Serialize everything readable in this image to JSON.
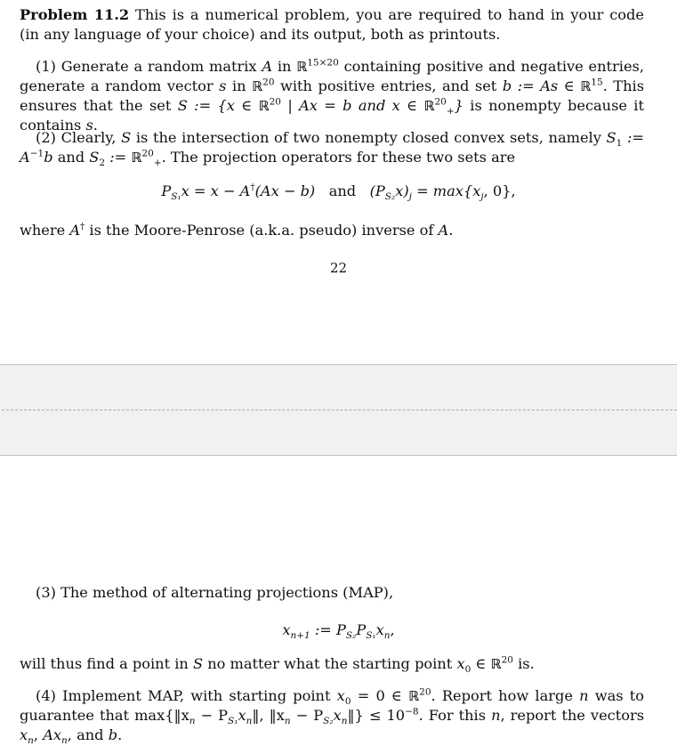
{
  "page1": {
    "problem_label": "Problem 11.2",
    "intro": " This is a numerical problem, you are required to hand in your code (in any language of your choice) and its output, both as printouts.",
    "part1": {
      "t1": "(1) Generate a random matrix ",
      "A": "A",
      "t2": " in ",
      "R": "ℝ",
      "dims": "15×20",
      "t3": " containing positive and negative entries, generate a random vector ",
      "s": "s",
      "t4": " in ",
      "dim20": "20",
      "t5": " with positive entries, and set ",
      "b_eq": "b := As ∈ ",
      "dim15": "15",
      "t6": ". This ensures that the set ",
      "set_def": "S := {x ∈ ",
      "set_mid": " | Ax = b and x ∈ ",
      "plus": "+",
      "set_end": "}",
      "t7": " is nonempty because it contains ",
      "t8": "."
    },
    "part2": {
      "t1": "(2) Clearly, ",
      "S": "S",
      "t2": " is the intersection of two nonempty closed convex sets, namely ",
      "S1def": "S",
      "S1sub": "1",
      "S1rest": " := A",
      "inv": "−1",
      "S1b": "b",
      "t3": " and ",
      "S2def": "S",
      "S2sub": "2",
      "S2rest": " := ",
      "t4": ". The projection operators for these two sets are"
    },
    "equation1": {
      "lhs": "P",
      "lhs_sub": "S₁",
      "lhs_rest": "x = x − A",
      "dagger": "†",
      "lhs_tail": "(Ax − b)",
      "and": "and",
      "rhs": "(P",
      "rhs_sub": "S₂",
      "rhs_mid": "x)",
      "rhs_j": "j",
      "rhs_tail": " = max{x",
      "rhs_tail2": ", 0},"
    },
    "where": {
      "t1": "where ",
      "A": "A",
      "dagger": "†",
      "t2": " is the Moore-Penrose (a.k.a. pseudo) inverse of ",
      "t3": "A",
      "t4": "."
    },
    "page_number": "22"
  },
  "page2": {
    "part3": {
      "t1": "(3) The method of alternating projections (MAP),"
    },
    "equation2": {
      "x": "x",
      "sub": "n+1",
      "mid": " := P",
      "s2": "S₂",
      "p": "P",
      "s1": "S₁",
      "xn": "x",
      "n": "n",
      "comma": ","
    },
    "will": {
      "t1": "will thus find a point in ",
      "S": "S",
      "t2": " no matter what the starting point ",
      "x0": "x",
      "zero": "0",
      "t3": " ∈ ",
      "R": "ℝ",
      "dim": "20",
      "t4": " is."
    },
    "part4": {
      "t1": "(4) Implement MAP, with starting point ",
      "x0": "x",
      "zero": "0",
      "t2": " = 0 ∈ ",
      "R": "ℝ",
      "dim": "20",
      "t3": ". Report how large ",
      "n": "n",
      "t4": " was to guarantee that max{‖x",
      "sub_n1": "n",
      "t5": " − P",
      "s1": "S₁",
      "t6": "x",
      "sub_n2": "n",
      "t7": "‖, ‖x",
      "sub_n3": "n",
      "t8": " − P",
      "s2": "S₂",
      "t9": "x",
      "sub_n4": "n",
      "t10": "‖} ≤ 10",
      "exp": "−8",
      "t11": ". For this ",
      "n2": "n",
      "t12": ", report the vectors ",
      "xn": "x",
      "sub_n5": "n",
      "t13": ", ",
      "Axn": "Ax",
      "sub_n6": "n",
      "t14": ", and ",
      "b": "b",
      "t15": "."
    }
  }
}
